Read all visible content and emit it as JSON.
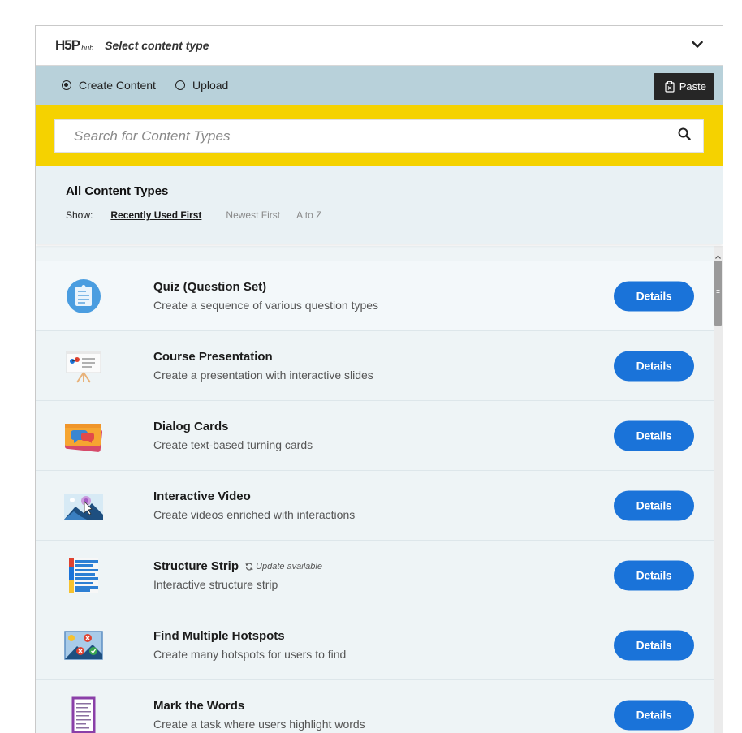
{
  "header": {
    "logo_main": "H5P",
    "logo_sub": "hub",
    "title": "Select content type"
  },
  "tabs": {
    "create_label": "Create Content",
    "upload_label": "Upload",
    "paste_label": "Paste"
  },
  "search": {
    "placeholder": "Search for Content Types"
  },
  "filter": {
    "title": "All Content Types",
    "show_label": "Show:",
    "options": [
      "Recently Used First",
      "Newest First",
      "A to Z"
    ],
    "active": "Recently Used First"
  },
  "items": [
    {
      "name": "Quiz (Question Set)",
      "desc": "Create a sequence of various question types",
      "icon": "quiz-icon",
      "update": ""
    },
    {
      "name": "Course Presentation",
      "desc": "Create a presentation with interactive slides",
      "icon": "presentation-icon",
      "update": ""
    },
    {
      "name": "Dialog Cards",
      "desc": "Create text-based turning cards",
      "icon": "dialog-cards-icon",
      "update": ""
    },
    {
      "name": "Interactive Video",
      "desc": "Create videos enriched with interactions",
      "icon": "interactive-video-icon",
      "update": ""
    },
    {
      "name": "Structure Strip",
      "desc": "Interactive structure strip",
      "icon": "structure-strip-icon",
      "update": "Update available"
    },
    {
      "name": "Find Multiple Hotspots",
      "desc": "Create many hotspots for users to find",
      "icon": "hotspots-icon",
      "update": ""
    },
    {
      "name": "Mark the Words",
      "desc": "Create a task where users highlight words",
      "icon": "mark-words-icon",
      "update": ""
    }
  ],
  "details_label": "Details",
  "colors": {
    "accent": "#1a73d9",
    "search_bar": "#f5d200",
    "tab_bar": "#b8d1da",
    "list_bg": "#eef4f6"
  }
}
